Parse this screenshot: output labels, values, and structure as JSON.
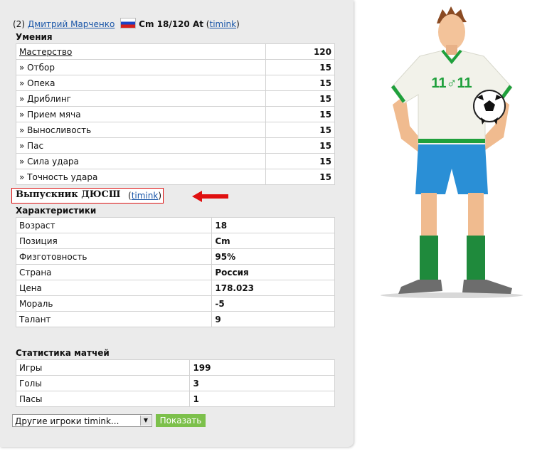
{
  "header": {
    "number": "(2)",
    "player_name": "Дмитрий Марченко",
    "position_age": "Cm 18/120 At",
    "owner_open": "(",
    "owner": "timink",
    "owner_close": ")"
  },
  "skills": {
    "title": "Умения",
    "rows": [
      {
        "label": "Мастерство",
        "value": "120"
      },
      {
        "label": "» Отбор",
        "value": "15"
      },
      {
        "label": "» Опека",
        "value": "15"
      },
      {
        "label": "» Дриблинг",
        "value": "15"
      },
      {
        "label": "» Прием мяча",
        "value": "15"
      },
      {
        "label": "» Выносливость",
        "value": "15"
      },
      {
        "label": "» Пас",
        "value": "15"
      },
      {
        "label": "» Сила удара",
        "value": "15"
      },
      {
        "label": "» Точность удара",
        "value": "15"
      }
    ]
  },
  "graduate": {
    "text": "Выпускник ДЮСШ",
    "link_open": "(",
    "link": "timink",
    "link_close": ")",
    "arrow_color": "#e01010"
  },
  "characteristics": {
    "title": "Характеристики",
    "rows": [
      {
        "label": "Возраст",
        "value": "18"
      },
      {
        "label": "Позиция",
        "value": "Cm"
      },
      {
        "label": "Физготовность",
        "value": "95%"
      },
      {
        "label": "Страна",
        "value": "Россия"
      },
      {
        "label": "Цена",
        "value": "178.023"
      },
      {
        "label": "Мораль",
        "value": "-5"
      },
      {
        "label": "Талант",
        "value": "9"
      }
    ]
  },
  "match_stats": {
    "title": "Статистика матчей",
    "rows": [
      {
        "label": "Игры",
        "value": "199"
      },
      {
        "label": "Голы",
        "value": "3"
      },
      {
        "label": "Пасы",
        "value": "1"
      }
    ]
  },
  "footer": {
    "select_value": "Другие игроки timink...",
    "show_button": "Показать",
    "button_color": "#7cc04b"
  },
  "player_image": {
    "shirt_text": "11♂11",
    "shirt_color": "#f2f2ea",
    "shorts_color": "#2a8fd6",
    "socks_color": "#1f8a3c"
  }
}
